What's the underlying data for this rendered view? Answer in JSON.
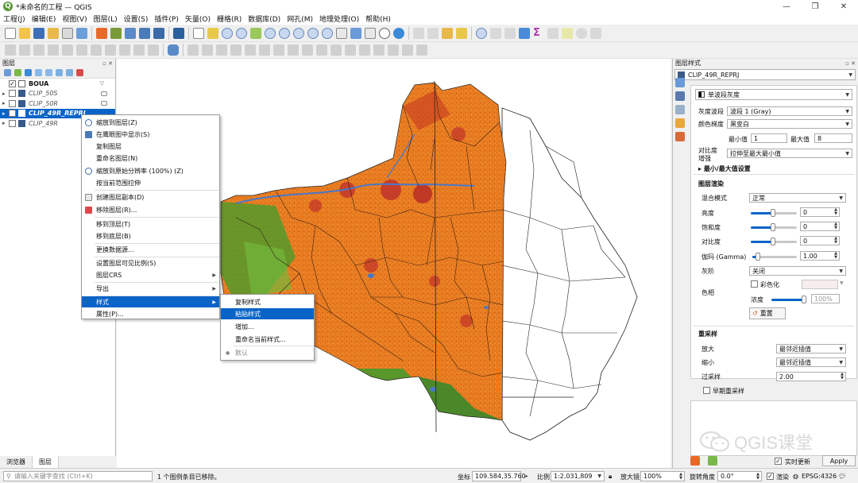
{
  "window": {
    "title": "*未命名的工程 — QGIS",
    "minimize": "—",
    "maximize": "❐",
    "close": "✕",
    "logo_letter": "Q"
  },
  "menu": [
    "工程(J)",
    "编辑(E)",
    "视图(V)",
    "图层(L)",
    "设置(S)",
    "插件(P)",
    "矢量(O)",
    "栅格(R)",
    "数据库(D)",
    "网孔(M)",
    "地理处理(O)",
    "帮助(H)"
  ],
  "layers_panel": {
    "title": "图层",
    "layers": [
      {
        "name": "BOUA",
        "checked": true,
        "style": "bold",
        "expand": ""
      },
      {
        "name": "CLIP_50S",
        "checked": false,
        "style": "italic",
        "expand": "▸"
      },
      {
        "name": "CLIP_50R",
        "checked": false,
        "style": "italic",
        "expand": "▸"
      },
      {
        "name": "CLIP_49R_REPRJ",
        "checked": true,
        "style": "selected",
        "expand": "▸"
      },
      {
        "name": "CLIP_49R",
        "checked": false,
        "style": "italic",
        "expand": "▸"
      }
    ],
    "tabs": [
      "浏览器",
      "图层"
    ]
  },
  "context_menu": [
    {
      "label": "缩放到图层(Z)",
      "icon": "zoom-layer-icon"
    },
    {
      "label": "在鹰眼图中显示(S)",
      "icon": "overview-icon"
    },
    {
      "label": "复制图层",
      "icon": ""
    },
    {
      "label": "重命名图层(N)",
      "icon": ""
    },
    {
      "label": "缩放到原始分辨率 (100%) (Z)",
      "icon": "zoom-native-icon"
    },
    {
      "label": "按当前范围拉伸",
      "icon": ""
    },
    {
      "label": "创建图层副本(D)",
      "icon": "duplicate-icon"
    },
    {
      "label": "移除图层(R)...",
      "icon": "remove-icon"
    },
    {
      "label": "移到顶层(T)",
      "icon": ""
    },
    {
      "label": "移到底层(B)",
      "icon": ""
    },
    {
      "label": "更换数据源...",
      "icon": ""
    },
    {
      "label": "设置图层可见比例(S)",
      "icon": ""
    },
    {
      "label": "图层CRS",
      "icon": "",
      "submenu": true
    },
    {
      "label": "导出",
      "icon": "",
      "submenu": true
    },
    {
      "label": "样式",
      "icon": "",
      "submenu": true,
      "highlight": true
    },
    {
      "label": "属性(P)...",
      "icon": ""
    }
  ],
  "submenu": [
    {
      "label": "复制样式",
      "highlight": false
    },
    {
      "label": "粘贴样式",
      "highlight": true
    },
    {
      "label": "增加...",
      "highlight": false
    },
    {
      "label": "重命名当前样式...",
      "highlight": false
    },
    {
      "label": "默认",
      "highlight": false,
      "bullet": "●"
    }
  ],
  "style_panel": {
    "title": "图层样式",
    "layer": "CLIP_49R_REPRJ",
    "renderer": "单波段灰度",
    "band_label": "灰度波段",
    "band": "波段 1 (Gray)",
    "gradient_label": "颜色梯度",
    "gradient": "黑变白",
    "min_label": "最小值",
    "min": "1",
    "max_label": "最大值",
    "max": "8",
    "contrast_label_1": "对比度",
    "contrast_label_2": "增强",
    "contrast": "拉伸至最大最小值",
    "minmax_section": "最小/最大值设置",
    "render_section": "图层渲染",
    "blend_label": "混合模式",
    "blend": "正常",
    "brightness_label": "亮度",
    "brightness": "0",
    "saturation_label": "饱和度",
    "saturation": "0",
    "contrast2_label": "对比度",
    "contrast2": "0",
    "gamma_label": "伽玛 (Gamma)",
    "gamma": "1.00",
    "grayscale_label": "灰阶",
    "grayscale": "关闭",
    "hue_label": "色相",
    "colorize_label": "彩色化",
    "strength_label": "浓度",
    "strength": "100%",
    "reset_label": "重置",
    "resample_section": "重采样",
    "zoomin_label": "放大",
    "zoomin": "最邻近插值",
    "zoomout_label": "缩小",
    "zoomout": "最邻近插值",
    "oversample_label": "过采样",
    "oversample": "2.00",
    "early_label": "早期重采样",
    "live_update": "实时更新",
    "apply": "Apply"
  },
  "status": {
    "search_placeholder": "请输入关键字查找 (Ctrl+K)",
    "message": "1 个图例条目已移除。",
    "coord_label": "坐标",
    "coord": "109.584,35.760",
    "scale_label": "比例",
    "scale": "1:2,031,809",
    "magnifier_label": "放大镜",
    "magnifier": "100%",
    "rotation_label": "旋转角度",
    "rotation": "0.0°",
    "render_label": "渲染",
    "crs": "EPSG:4326"
  },
  "watermark": "QGIS课堂",
  "colors": {
    "raster_orange": "#e87d21",
    "raster_red": "#c73a22",
    "raster_green": "#3f9b2c",
    "selection": "#0a64c8",
    "qgis_green": "#589632"
  }
}
